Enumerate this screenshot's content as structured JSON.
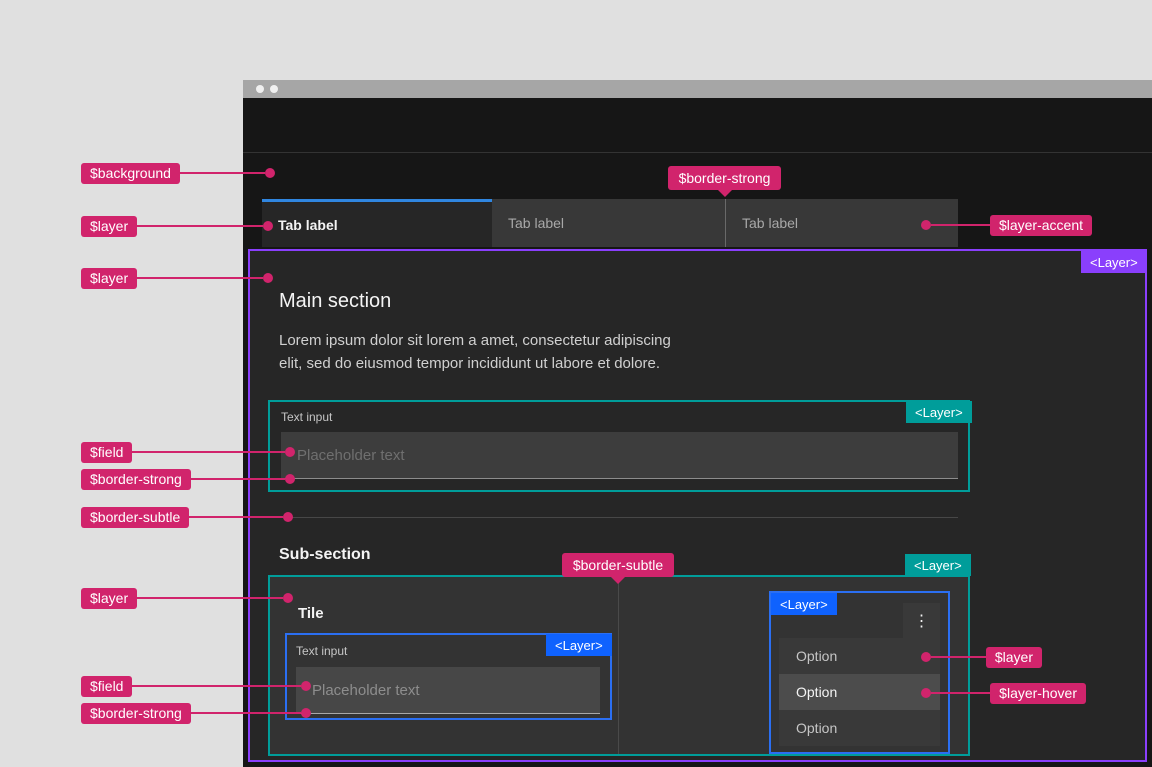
{
  "colors": {
    "annotation_pink": "#d1246c",
    "layer_purple": "#8a3ffc",
    "layer_teal": "#009d9a",
    "layer_blue": "#0f62fe",
    "tab_selected_underline": "#3086e0",
    "background_dark": "#161616",
    "layer_01": "#262626",
    "layer_02": "#333333",
    "layer_accent": "#383838",
    "layer_hover": "#4c4c4c",
    "field_01": "#3d3d3d",
    "field_02": "#474747"
  },
  "icons": {
    "overflow": "⋮"
  },
  "layer_badge_label": "<Layer>",
  "tabs": [
    "Tab label",
    "Tab label",
    "Tab label"
  ],
  "main": {
    "heading": "Main section",
    "body": "Lorem ipsum dolor sit lorem a amet, consectetur adipiscing\nelit, sed do eiusmod tempor incididunt ut labore et dolore.",
    "text_input": {
      "label": "Text input",
      "placeholder": "Placeholder text"
    },
    "subsection": {
      "heading": "Sub-section",
      "tile": {
        "heading": "Tile",
        "text_input": {
          "label": "Text input",
          "placeholder": "Placeholder text"
        }
      },
      "menu": {
        "options": [
          "Option",
          "Option",
          "Option"
        ]
      }
    }
  },
  "annotations": {
    "left": [
      "$background",
      "$layer",
      "$layer",
      "$field",
      "$border-strong",
      "$border-subtle",
      "$layer",
      "$field",
      "$border-strong"
    ],
    "right": [
      "$layer-accent",
      "$layer",
      "$layer-hover"
    ],
    "tooltip_tabs": "$border-strong",
    "tooltip_subsection": "$border-subtle"
  }
}
